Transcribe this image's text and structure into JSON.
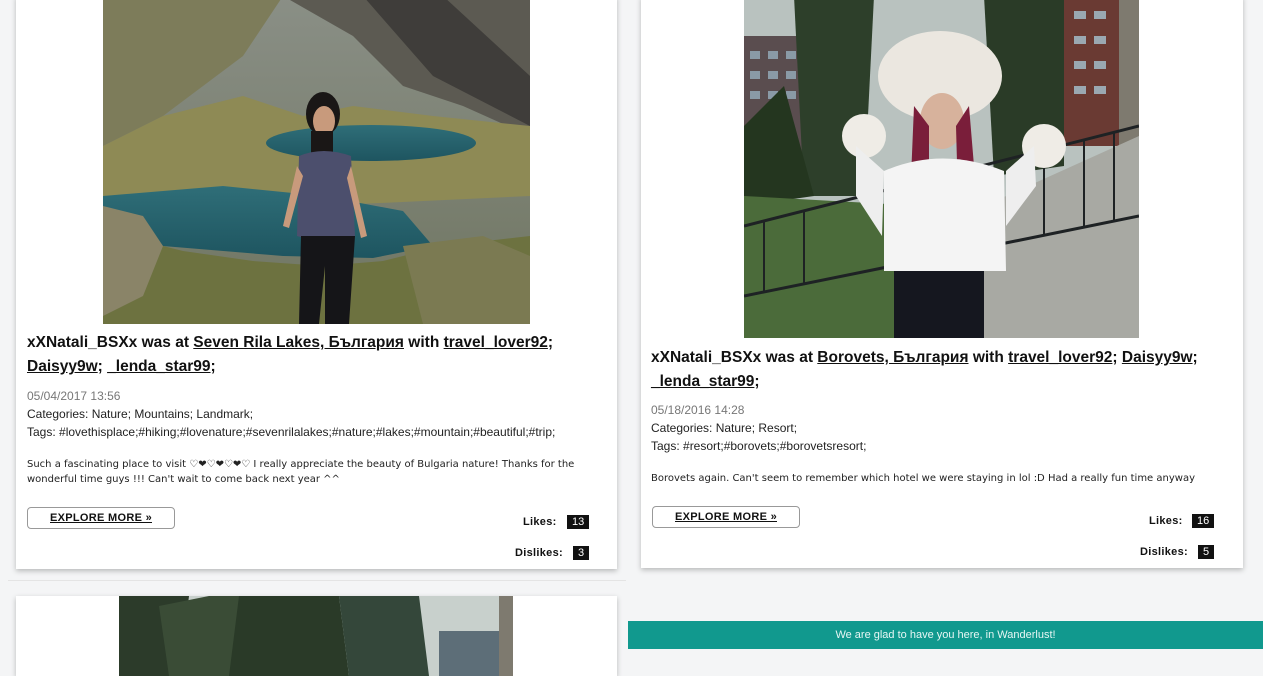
{
  "posts": [
    {
      "user": "xXNatali_BSXx",
      "was_at": "was at",
      "location": "Seven Rila Lakes, България",
      "with": "with",
      "companions": [
        "travel_lover92",
        "Daisyy9w",
        "_lenda_star99"
      ],
      "date": "05/04/2017 13:56",
      "categories": "Categories: Nature; Mountains; Landmark;",
      "tags": "Tags: #lovethisplace;#hiking;#lovenature;#sevenrilalakes;#nature;#lakes;#mountain;#beautiful;#trip;",
      "description": "Such a fascinating place to visit ♡❤♡❤♡❤♡ I really appreciate the beauty of Bulgaria nature! Thanks for the wonderful time guys !!! Can't wait to come back next year ^^",
      "explore_label": "EXPLORE MORE »",
      "likes_label": "Likes:",
      "likes": "13",
      "dislikes_label": "Dislikes:",
      "dislikes": "3"
    },
    {
      "user": "xXNatali_BSXx",
      "was_at": "was at",
      "location": "Borovets, България",
      "with": "with",
      "companions": [
        "travel_lover92",
        "Daisyy9w",
        "_lenda_star99"
      ],
      "date": "05/18/2016 14:28",
      "categories": "Categories: Nature; Resort;",
      "tags": "Tags: #resort;#borovets;#borovetsresort;",
      "description": "Borovets again. Can't seem to remember which hotel we were staying in lol :D Had a really fun time anyway",
      "explore_label": "EXPLORE MORE »",
      "likes_label": "Likes:",
      "likes": "16",
      "dislikes_label": "Dislikes:",
      "dislikes": "5"
    }
  ],
  "banner": {
    "text": "We are glad to have you here, in Wanderlust!"
  },
  "colors": {
    "banner_bg": "#11998e",
    "badge_bg": "#111111"
  }
}
